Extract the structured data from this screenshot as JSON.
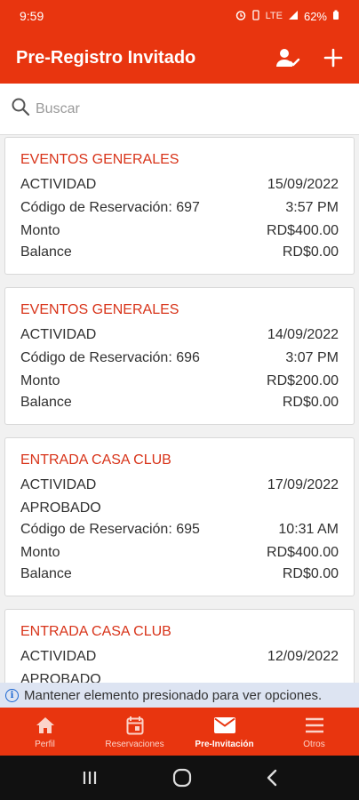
{
  "status_bar": {
    "time": "9:59",
    "signal_text": "LTE",
    "battery": "62%"
  },
  "app_bar": {
    "title": "Pre-Registro Invitado"
  },
  "search": {
    "placeholder": "Buscar"
  },
  "cards": [
    {
      "title": "EVENTOS GENERALES",
      "activity_label": "ACTIVIDAD",
      "date": "15/09/2022",
      "code": "Código de Reservación: 697",
      "time": "3:57 PM",
      "amount_label": "Monto",
      "amount": "RD$400.00",
      "balance_label": "Balance",
      "balance": "RD$0.00"
    },
    {
      "title": "EVENTOS GENERALES",
      "activity_label": "ACTIVIDAD",
      "date": "14/09/2022",
      "code": "Código de Reservación: 696",
      "time": "3:07 PM",
      "amount_label": "Monto",
      "amount": "RD$200.00",
      "balance_label": "Balance",
      "balance": "RD$0.00"
    },
    {
      "title": "ENTRADA CASA CLUB",
      "activity_label": "ACTIVIDAD",
      "date": "17/09/2022",
      "status": "APROBADO",
      "code": "Código de Reservación: 695",
      "time": "10:31 AM",
      "amount_label": "Monto",
      "amount": "RD$400.00",
      "balance_label": "Balance",
      "balance": "RD$0.00"
    },
    {
      "title": "ENTRADA CASA CLUB",
      "activity_label": "ACTIVIDAD",
      "date": "12/09/2022",
      "status": "APROBADO"
    }
  ],
  "hint": {
    "text": "Mantener elemento presionado para ver opciones."
  },
  "bottom_nav": {
    "items": [
      {
        "label": "Perfil",
        "icon": "home-icon"
      },
      {
        "label": "Reservaciones",
        "icon": "calendar-icon"
      },
      {
        "label": "Pre-Invitación",
        "icon": "mail-icon",
        "active": true
      },
      {
        "label": "Otros",
        "icon": "menu-icon"
      }
    ]
  },
  "colors": {
    "primary": "#e8350f",
    "card_title": "#d8341a",
    "hint_bg": "#dde4f2"
  }
}
